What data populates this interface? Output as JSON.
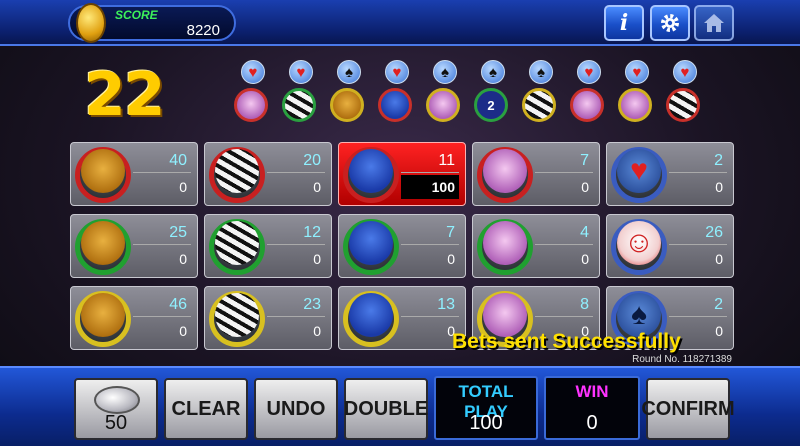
{
  "header": {
    "score_label": "SCORE",
    "score_value": "8220",
    "info_label": "i",
    "settings_icon": "gear-icon",
    "home_icon": "home-icon"
  },
  "countdown": "22",
  "history": [
    {
      "suit": "heart",
      "animal": "owl",
      "ring": "#c8302a"
    },
    {
      "suit": "heart",
      "animal": "zebra",
      "ring": "#2aa040"
    },
    {
      "suit": "spade",
      "animal": "lion",
      "ring": "#d0b020"
    },
    {
      "suit": "heart",
      "animal": "bird",
      "ring": "#c8302a"
    },
    {
      "suit": "spade",
      "animal": "owl",
      "ring": "#d0b020"
    },
    {
      "suit": "spade",
      "animal": "2",
      "ring": "#2aa040"
    },
    {
      "suit": "spade",
      "animal": "zebra",
      "ring": "#d0b020"
    },
    {
      "suit": "heart",
      "animal": "owl",
      "ring": "#c8302a"
    },
    {
      "suit": "heart",
      "animal": "owl",
      "ring": "#d0b020"
    },
    {
      "suit": "heart",
      "animal": "zebra",
      "ring": "#c8302a"
    }
  ],
  "grid": {
    "rows": [
      {
        "ring_color": "#c82020",
        "cells": [
          {
            "animal": "lion",
            "odds": "40",
            "bet": "0"
          },
          {
            "animal": "zebra",
            "odds": "20",
            "bet": "0"
          },
          {
            "animal": "bird",
            "odds": "11",
            "bet": "100",
            "selected": true
          },
          {
            "animal": "owl",
            "odds": "7",
            "bet": "0"
          },
          {
            "animal": "heart",
            "odds": "2",
            "bet": "0"
          }
        ]
      },
      {
        "ring_color": "#20a030",
        "cells": [
          {
            "animal": "lion",
            "odds": "25",
            "bet": "0"
          },
          {
            "animal": "zebra",
            "odds": "12",
            "bet": "0"
          },
          {
            "animal": "bird",
            "odds": "7",
            "bet": "0"
          },
          {
            "animal": "owl",
            "odds": "4",
            "bet": "0"
          },
          {
            "animal": "clown",
            "odds": "26",
            "bet": "0"
          }
        ]
      },
      {
        "ring_color": "#d8c020",
        "cells": [
          {
            "animal": "lion",
            "odds": "46",
            "bet": "0"
          },
          {
            "animal": "zebra",
            "odds": "23",
            "bet": "0"
          },
          {
            "animal": "bird",
            "odds": "13",
            "bet": "0"
          },
          {
            "animal": "owl",
            "odds": "8",
            "bet": "0"
          },
          {
            "animal": "spade",
            "odds": "2",
            "bet": "0"
          }
        ]
      }
    ]
  },
  "message": "Bets sent Successfully",
  "round_label": "Round No. 118271389",
  "footer": {
    "chip_value": "50",
    "clear_label": "CLEAR",
    "undo_label": "UNDO",
    "double_label": "DOUBLE",
    "total_play_label": "TOTAL PLAY",
    "total_play_value": "100",
    "win_label": "WIN",
    "win_value": "0",
    "confirm_label": "CONFIRM"
  },
  "colors": {
    "accent_yellow": "#ffcc00",
    "score_green": "#3cf05a",
    "total_play_cyan": "#33ccff",
    "win_magenta": "#ff33ff",
    "odds_cyan": "#8ff0ff"
  }
}
